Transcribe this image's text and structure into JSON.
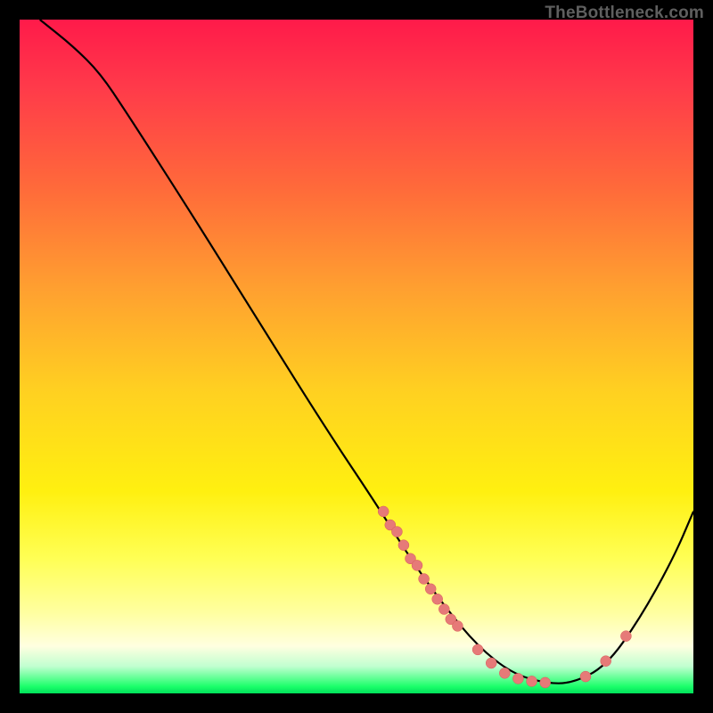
{
  "watermark": "TheBottleneck.com",
  "colors": {
    "background": "#000000",
    "curve_stroke": "#000000",
    "marker_fill": "#e67a78",
    "marker_stroke": "#d85a58"
  },
  "chart_data": {
    "type": "line",
    "title": "",
    "xlabel": "",
    "ylabel": "",
    "xlim": [
      0,
      100
    ],
    "ylim": [
      0,
      100
    ],
    "grid": false,
    "legend": null,
    "curve": [
      {
        "x": 3,
        "y": 100
      },
      {
        "x": 8,
        "y": 96
      },
      {
        "x": 12,
        "y": 92
      },
      {
        "x": 16,
        "y": 86
      },
      {
        "x": 25,
        "y": 72
      },
      {
        "x": 35,
        "y": 56
      },
      {
        "x": 45,
        "y": 40
      },
      {
        "x": 53,
        "y": 28
      },
      {
        "x": 58,
        "y": 20
      },
      {
        "x": 63,
        "y": 13
      },
      {
        "x": 68,
        "y": 7
      },
      {
        "x": 73,
        "y": 3
      },
      {
        "x": 78,
        "y": 1.5
      },
      {
        "x": 82,
        "y": 1.5
      },
      {
        "x": 87,
        "y": 4
      },
      {
        "x": 92,
        "y": 11
      },
      {
        "x": 97,
        "y": 20
      },
      {
        "x": 100,
        "y": 27
      }
    ],
    "markers": [
      {
        "x": 54,
        "y": 27
      },
      {
        "x": 55,
        "y": 25
      },
      {
        "x": 56,
        "y": 24
      },
      {
        "x": 57,
        "y": 22
      },
      {
        "x": 58,
        "y": 20
      },
      {
        "x": 59,
        "y": 19
      },
      {
        "x": 60,
        "y": 17
      },
      {
        "x": 61,
        "y": 15.5
      },
      {
        "x": 62,
        "y": 14
      },
      {
        "x": 63,
        "y": 12.5
      },
      {
        "x": 64,
        "y": 11
      },
      {
        "x": 65,
        "y": 10
      },
      {
        "x": 68,
        "y": 6.5
      },
      {
        "x": 70,
        "y": 4.5
      },
      {
        "x": 72,
        "y": 3
      },
      {
        "x": 74,
        "y": 2.2
      },
      {
        "x": 76,
        "y": 1.8
      },
      {
        "x": 78,
        "y": 1.6
      },
      {
        "x": 84,
        "y": 2.5
      },
      {
        "x": 87,
        "y": 4.8
      },
      {
        "x": 90,
        "y": 8.5
      }
    ]
  }
}
